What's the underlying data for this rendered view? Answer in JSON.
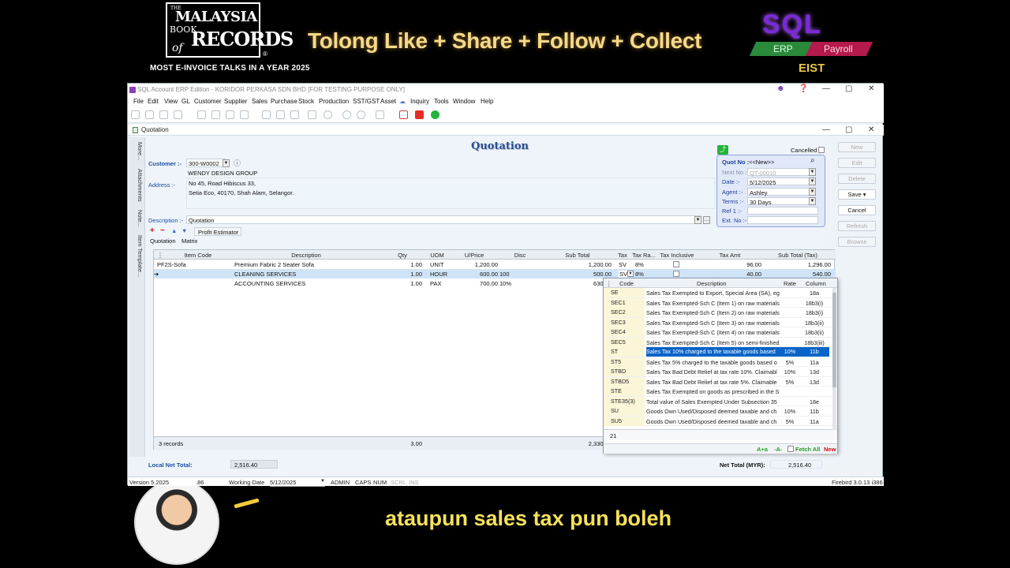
{
  "overlay": {
    "logo_top": "THE",
    "logo_malaysia": "MALAYSIA",
    "logo_book": "BOOK",
    "logo_of": "of",
    "logo_records": "RECORDS",
    "registered": "®",
    "talks": "MOST E-INVOICE TALKS IN A YEAR 2025",
    "headline": "Tolong Like + Share + Follow + Collect",
    "sql": "SQL",
    "erp": "ERP",
    "payroll": "Payroll",
    "eist": "EIST",
    "subtitle": "ataupun sales tax pun boleh"
  },
  "window": {
    "title": "SQL Account ERP Edition - KORIDOR PERKASA SDN BHD [FOR TESTING PURPOSE ONLY]",
    "minimize": "—",
    "maximize": "▢",
    "close": "✕"
  },
  "menu": [
    "File",
    "Edit",
    "View",
    "GL",
    "Customer",
    "Supplier",
    "Sales",
    "Purchase",
    "Stock",
    "Production",
    "SST/GST",
    "Asset",
    "Inquiry",
    "Tools",
    "Window",
    "Help"
  ],
  "doc": {
    "window_title": "Quotation",
    "side_tabs": [
      "More...",
      "Attachments",
      "Note...",
      "Item Template..."
    ],
    "title": "Quotation",
    "customer_label": "Customer :-",
    "customer_code": "300-W0002",
    "customer_name": "WENDY DESIGN GROUP",
    "address_label": "Address :-",
    "address_line1": "No 45, Road Hibiscus 33,",
    "address_line2": "Setia Eco, 40170, Shah Alam, Selangor.",
    "description_label": "Description :-",
    "description_value": "Quotation",
    "cancelled_label": "Cancelled",
    "profit_estimator": "Profit Estimator",
    "tab_quotation": "Quotation",
    "tab_matrix": "Matrix"
  },
  "quot": {
    "quot_no_label": "Quot No :",
    "quot_no_value": "<<New>>",
    "next_no_label": "Next No :-",
    "next_no_value": "QT-00010",
    "date_label": "Date :-",
    "date_value": "5/12/2025",
    "agent_label": "Agent :-",
    "agent_value": "Ashley",
    "terms_label": "Terms :-",
    "terms_value": "30 Days",
    "ref1_label": "Ref 1 :-",
    "extno_label": "Ext. No :-"
  },
  "actions": {
    "new": "New",
    "edit": "Edit",
    "delete": "Delete",
    "save": "Save",
    "cancel": "Cancel",
    "refresh": "Refresh",
    "browse": "Browse"
  },
  "grid": {
    "headers": [
      "Item Code",
      "Description",
      "Qty",
      "UOM",
      "U/Price",
      "Disc",
      "Sub Total",
      "Tax",
      "Tax Ra...",
      "Tax Inclusive",
      "Tax Amt",
      "Sub Total (Tax)"
    ],
    "rows": [
      {
        "code": "PF2S-Sofa",
        "desc": "Premium Fabric 2 Seater Sofa",
        "qty": "1.00",
        "uom": "UNIT",
        "price": "1,200.00",
        "disc": "",
        "subtotal": "1,200.00",
        "tax": "SV",
        "rate": "8%",
        "taxamt": "96.00",
        "subtax": "1,296.00"
      },
      {
        "code": "",
        "desc": "CLEANING SERVICES",
        "qty": "1.00",
        "uom": "HOUR",
        "price": "600.00",
        "disc": "100",
        "subtotal": "500.00",
        "tax": "SV",
        "rate": "8%",
        "taxamt": "40.00",
        "subtax": "540.00"
      },
      {
        "code": "",
        "desc": "ACCOUNTING SERVICES",
        "qty": "1.00",
        "uom": "PAX",
        "price": "700.00",
        "disc": "10%",
        "subtotal": "630.00",
        "tax": "",
        "rate": "",
        "taxamt": "",
        "subtax": ""
      }
    ],
    "records": "3 records",
    "total_qty": "3.00",
    "total_subtotal": "2,330.00"
  },
  "totals": {
    "local_label": "Local Net Total:",
    "local_value": "2,516.40",
    "net_label": "Net Total (MYR):",
    "net_value": "2,516.40"
  },
  "tax_popup": {
    "headers": [
      "Code",
      "Description",
      "Rate",
      "Column"
    ],
    "rows": [
      {
        "code": "SE",
        "desc": "Sales Tax Exempted to Export, Special Area (SA), eg",
        "rate": "",
        "col": "18a"
      },
      {
        "code": "SEC1",
        "desc": "Sales Tax Exempted-Sch C (Item 1) on raw materials",
        "rate": "",
        "col": "18b3(i)"
      },
      {
        "code": "SEC2",
        "desc": "Sales Tax Exempted-Sch C (Item 2) on raw materials",
        "rate": "",
        "col": "18b3(i)"
      },
      {
        "code": "SEC3",
        "desc": "Sales Tax Exempted-Sch C (Item 3) on raw materials",
        "rate": "",
        "col": "18b3(ii)"
      },
      {
        "code": "SEC4",
        "desc": "Sales Tax Exempted-Sch C (Item 4) on raw materials",
        "rate": "",
        "col": "18b3(ii)"
      },
      {
        "code": "SEC5",
        "desc": "Sales Tax Exempted-Sch C (Item 5) on semi-finished",
        "rate": "",
        "col": "18b3(iii)"
      },
      {
        "code": "ST",
        "desc": "Sales Tax 10% charged to the taxable goods based",
        "rate": "10%",
        "col": "11b"
      },
      {
        "code": "ST5",
        "desc": "Sales Tax 5% charged to the taxable goods based o",
        "rate": "5%",
        "col": "11a"
      },
      {
        "code": "STBD",
        "desc": "Sales Tax Bad Debt Relief at tax rate 10%. Claimabl",
        "rate": "10%",
        "col": "13d"
      },
      {
        "code": "STBD5",
        "desc": "Sales Tax Bad Debt Relief at tax rate 5%. Claimable",
        "rate": "5%",
        "col": "13d"
      },
      {
        "code": "STE",
        "desc": "Sales Tax Exempted on goods as prescribed in the S",
        "rate": "",
        "col": ""
      },
      {
        "code": "STE35(3)",
        "desc": "Total value of Sales Exempted Under Subsection 35",
        "rate": "",
        "col": "18e"
      },
      {
        "code": "SU",
        "desc": "Goods Own Used/Disposed deemed taxable and ch",
        "rate": "10%",
        "col": "11b"
      },
      {
        "code": "SU5",
        "desc": "Goods Own Used/Disposed deemed taxable and ch",
        "rate": "5%",
        "col": "11a"
      }
    ],
    "count": "21",
    "font_up": "A+a",
    "font_down": "-A-",
    "fetch_all": "Fetch All",
    "new": "New"
  },
  "status": {
    "version": "Version 5.2025",
    "version_tail": ".86",
    "working_date_label": "Working Date",
    "working_date_value": "5/12/2025",
    "admin": "ADMIN",
    "caps": "CAPS",
    "num": "NUM",
    "scrl": "SCRL",
    "ins": "INS",
    "db": "Firebird 3.0.13 i386"
  },
  "colors": {
    "accent_blue": "#1f4f9f",
    "popup_highlight": "#0a64c8",
    "new_red": "#d01010",
    "fetch_green": "#2a9a2a"
  }
}
